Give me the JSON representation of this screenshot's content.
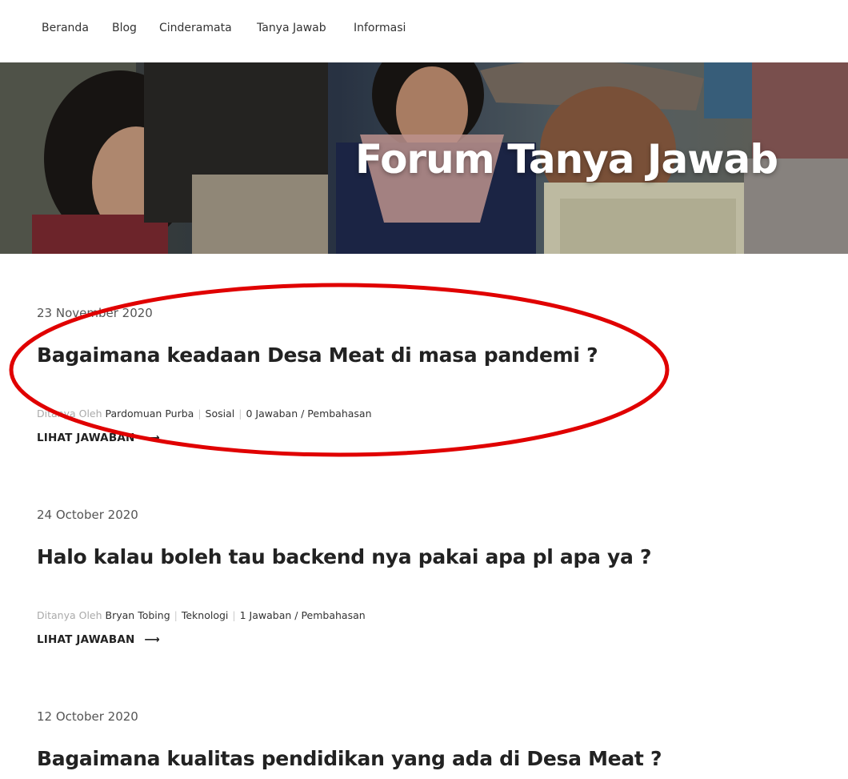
{
  "nav": {
    "items": [
      {
        "label": "Beranda"
      },
      {
        "label": "Blog"
      },
      {
        "label": "Cinderamata"
      },
      {
        "label": "Tanya Jawab"
      },
      {
        "label": "Informasi"
      }
    ]
  },
  "hero": {
    "title": "Forum Tanya Jawab"
  },
  "posts": [
    {
      "date": "23 November 2020",
      "title": "Bagaimana keadaan Desa Meat di masa pandemi ?",
      "meta_prefix": "Ditanya Oleh",
      "author": "Pardomuan Purba",
      "category": "Sosial",
      "answers": "0 Jawaban / Pembahasan",
      "read_more": "LIHAT JAWABAN"
    },
    {
      "date": "24 October 2020",
      "title": "Halo kalau boleh tau backend nya pakai apa pl apa ya ?",
      "meta_prefix": "Ditanya Oleh",
      "author": "Bryan Tobing",
      "category": "Teknologi",
      "answers": "1 Jawaban / Pembahasan",
      "read_more": "LIHAT JAWABAN"
    },
    {
      "date": "12 October 2020",
      "title": "Bagaimana kualitas pendidikan yang ada di Desa Meat ?"
    }
  ],
  "colors": {
    "highlight": "#e00000",
    "text": "#222222"
  }
}
